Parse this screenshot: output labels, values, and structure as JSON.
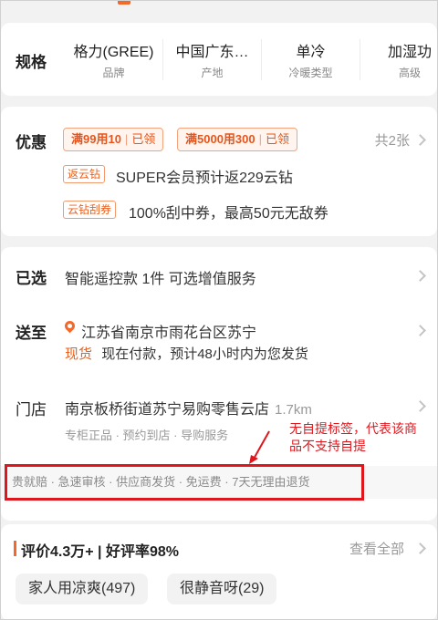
{
  "spec": {
    "label": "规格",
    "items": [
      {
        "value": "格力(GREE)",
        "key": "品牌"
      },
      {
        "value": "中国广东…",
        "key": "产地"
      },
      {
        "value": "单冷",
        "key": "冷暖类型"
      },
      {
        "value": "加湿功",
        "key": "高级"
      }
    ]
  },
  "promo": {
    "label": "优惠",
    "coupon1": {
      "text": "满99用10",
      "status": "已领"
    },
    "coupon2": {
      "text": "满5000用300",
      "status": "已领"
    },
    "count": "共2张",
    "line1": {
      "tag": "返云钻",
      "text": "SUPER会员预计返229云钻"
    },
    "line2": {
      "tag": "云钻刮券",
      "text": "100%刮中券，最高50元无敌券"
    }
  },
  "detail": {
    "selected": {
      "label": "已选",
      "text": "智能遥控款  1件  可选增值服务"
    },
    "ship": {
      "label": "送至",
      "address": "江苏省南京市雨花台区苏宁",
      "stock": "现货",
      "eta": "现在付款，预计48小时内为您发货"
    },
    "store": {
      "label": "门店",
      "name": "南京板桥街道苏宁易购零售云店",
      "distance": "1.7km",
      "services": "专柜正品 · 预约到店 · 导购服务"
    },
    "guarantee": "贵就赔 · 急速审核 · 供应商发货 · 免运费 · 7天无理由退货"
  },
  "annotation": {
    "text": "无自提标签，代表该商品不支持自提",
    "color": "#e0161d"
  },
  "review": {
    "title": "评价4.3万+ | 好评率98%",
    "view_all": "查看全部",
    "chips": [
      "家人用凉爽(497)",
      "很静音呀(29)"
    ]
  },
  "colors": {
    "accent": "#f2692a",
    "annotation": "#e0161d"
  }
}
